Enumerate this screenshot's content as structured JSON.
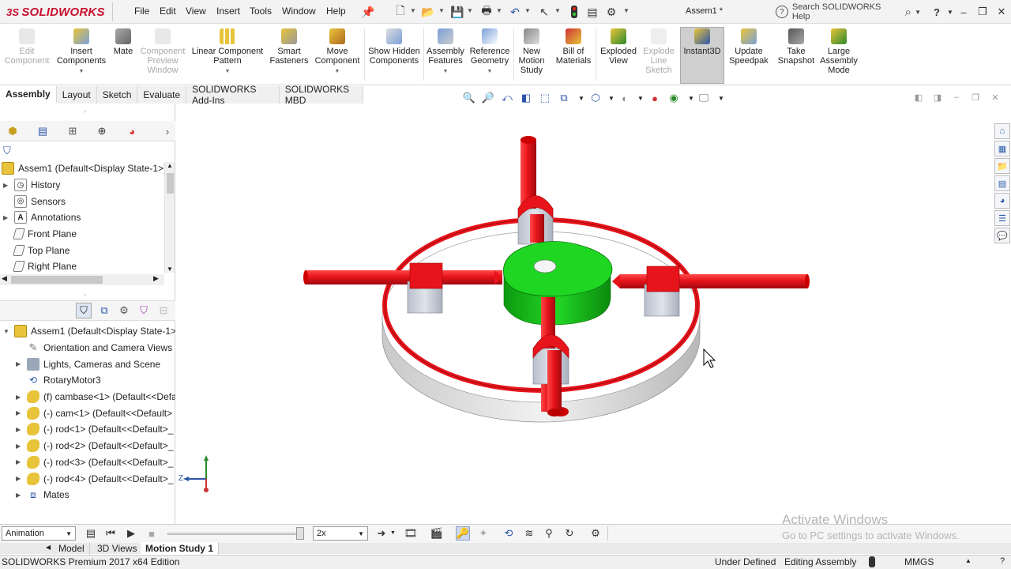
{
  "app": {
    "brand": "SOLIDWORKS",
    "brand_prefix": "3S",
    "document_title": "Assem1 *"
  },
  "menu": [
    "File",
    "Edit",
    "View",
    "Insert",
    "Tools",
    "Window",
    "Help"
  ],
  "help_search": {
    "placeholder": "Search SOLIDWORKS Help"
  },
  "ribbon": {
    "buttons": [
      {
        "label": "Edit Component",
        "disabled": true
      },
      {
        "label": "Insert Components",
        "disabled": false
      },
      {
        "label": "Mate",
        "disabled": false
      },
      {
        "label": "Component Preview Window",
        "disabled": true
      },
      {
        "label": "Linear Component Pattern",
        "disabled": false
      },
      {
        "label": "Smart Fasteners",
        "disabled": false
      },
      {
        "label": "Move Component",
        "disabled": false
      },
      {
        "label": "Show Hidden Components",
        "disabled": false
      },
      {
        "label": "Assembly Features",
        "disabled": false
      },
      {
        "label": "Reference Geometry",
        "disabled": false
      },
      {
        "label": "New Motion Study",
        "disabled": false
      },
      {
        "label": "Bill of Materials",
        "disabled": false
      },
      {
        "label": "Exploded View",
        "disabled": false
      },
      {
        "label": "Explode Line Sketch",
        "disabled": true
      },
      {
        "label": "Instant3D",
        "disabled": false,
        "active": true
      },
      {
        "label": "Update Speedpak",
        "disabled": false
      },
      {
        "label": "Take Snapshot",
        "disabled": false
      },
      {
        "label": "Large Assembly Mode",
        "disabled": false
      }
    ]
  },
  "command_tabs": [
    "Assembly",
    "Layout",
    "Sketch",
    "Evaluate",
    "SOLIDWORKS Add-Ins",
    "SOLIDWORKS MBD"
  ],
  "feature_tree": {
    "root": "Assem1  (Default<Display State-1>)",
    "items": [
      "History",
      "Sensors",
      "Annotations",
      "Front Plane",
      "Top Plane",
      "Right Plane"
    ]
  },
  "motion_tree": {
    "root": "Assem1  (Default<Display State-1>)",
    "items": [
      "Orientation and Camera Views",
      "Lights, Cameras and Scene",
      "RotaryMotor3",
      "(f) cambase<1> (Default<<Defa",
      "(-) cam<1> (Default<<Default>",
      "(-) rod<1> (Default<<Default>_",
      "(-) rod<2> (Default<<Default>_",
      "(-) rod<3> (Default<<Default>_",
      "(-) rod<4> (Default<<Default>_",
      "Mates"
    ]
  },
  "triad": {
    "x_label": "Z"
  },
  "motion_toolbar": {
    "study_type": "Animation",
    "playback_speed": "2x"
  },
  "bottom_tabs": [
    "Model",
    "3D Views",
    "Motion Study 1"
  ],
  "status": {
    "edition": "SOLIDWORKS Premium 2017 x64 Edition",
    "definition": "Under Defined",
    "mode": "Editing Assembly",
    "units": "MMGS"
  },
  "watermark": {
    "line1": "Activate Windows",
    "line2": "Go to PC settings to activate Windows."
  },
  "colors": {
    "rod": "#e8141b",
    "cam": "#18c11a",
    "base": "#d9d9d9",
    "brand": "#c8102e",
    "active_button": "#cfcfcf"
  }
}
